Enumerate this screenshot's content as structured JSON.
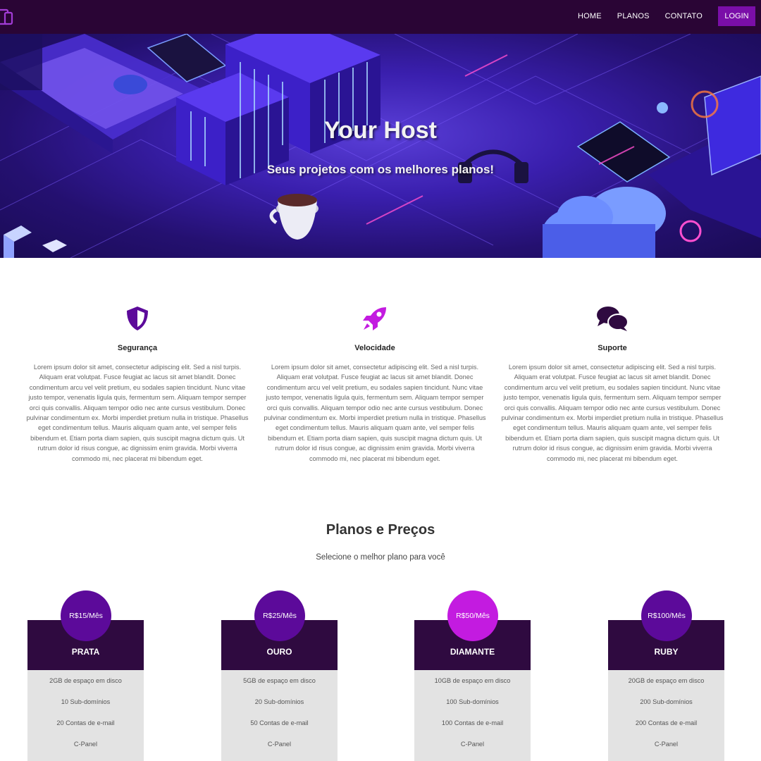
{
  "nav": {
    "logo_icon": "devices-icon",
    "links": [
      {
        "label": "HOME"
      },
      {
        "label": "PLANOS"
      },
      {
        "label": "CONTATO"
      }
    ],
    "login_label": "LOGIN",
    "background": "#2a0535",
    "accent": "#7a0ea8"
  },
  "hero": {
    "title": "Your Host",
    "subtitle": "Seus projetos com os melhores planos!"
  },
  "features": [
    {
      "icon": "shield-icon",
      "title": "Segurança",
      "text": "Lorem ipsum dolor sit amet, consectetur adipiscing elit. Sed a nisl turpis. Aliquam erat volutpat. Fusce feugiat ac lacus sit amet blandit. Donec condimentum arcu vel velit pretium, eu sodales sapien tincidunt. Nunc vitae justo tempor, venenatis ligula quis, fermentum sem. Aliquam tempor semper orci quis convallis. Aliquam tempor odio nec ante cursus vestibulum. Donec pulvinar condimentum ex. Morbi imperdiet pretium nulla in tristique. Phasellus eget condimentum tellus. Mauris aliquam quam ante, vel semper felis bibendum et. Etiam porta diam sapien, quis suscipit magna dictum quis. Ut rutrum dolor id risus congue, ac dignissim enim gravida. Morbi viverra commodo mi, nec placerat mi bibendum eget."
    },
    {
      "icon": "rocket-icon",
      "title": "Velocidade",
      "text": "Lorem ipsum dolor sit amet, consectetur adipiscing elit. Sed a nisl turpis. Aliquam erat volutpat. Fusce feugiat ac lacus sit amet blandit. Donec condimentum arcu vel velit pretium, eu sodales sapien tincidunt. Nunc vitae justo tempor, venenatis ligula quis, fermentum sem. Aliquam tempor semper orci quis convallis. Aliquam tempor odio nec ante cursus vestibulum. Donec pulvinar condimentum ex. Morbi imperdiet pretium nulla in tristique. Phasellus eget condimentum tellus. Mauris aliquam quam ante, vel semper felis bibendum et. Etiam porta diam sapien, quis suscipit magna dictum quis. Ut rutrum dolor id risus congue, ac dignissim enim gravida. Morbi viverra commodo mi, nec placerat mi bibendum eget."
    },
    {
      "icon": "chat-bubbles-icon",
      "title": "Suporte",
      "text": "Lorem ipsum dolor sit amet, consectetur adipiscing elit. Sed a nisl turpis. Aliquam erat volutpat. Fusce feugiat ac lacus sit amet blandit. Donec condimentum arcu vel velit pretium, eu sodales sapien tincidunt. Nunc vitae justo tempor, venenatis ligula quis, fermentum sem. Aliquam tempor semper orci quis convallis. Aliquam tempor odio nec ante cursus vestibulum. Donec pulvinar condimentum ex. Morbi imperdiet pretium nulla in tristique. Phasellus eget condimentum tellus. Mauris aliquam quam ante, vel semper felis bibendum et. Etiam porta diam sapien, quis suscipit magna dictum quis. Ut rutrum dolor id risus congue, ac dignissim enim gravida. Morbi viverra commodo mi, nec placerat mi bibendum eget."
    }
  ],
  "plans_section": {
    "title": "Planos e Preços",
    "subtitle": "Selecione o melhor plano para você"
  },
  "plans": [
    {
      "price": "R$15/Mês",
      "name": "PRATA",
      "price_color": "#5c0a9a",
      "features": [
        "2GB de espaço em disco",
        "10 Sub-domínios",
        "20 Contas de e-mail",
        "C-Panel"
      ]
    },
    {
      "price": "R$25/Mês",
      "name": "OURO",
      "price_color": "#5c0a9a",
      "features": [
        "5GB de espaço em disco",
        "20 Sub-domínios",
        "50 Contas de e-mail",
        "C-Panel"
      ]
    },
    {
      "price": "R$50/Mês",
      "name": "DIAMANTE",
      "price_color": "#c31be0",
      "features": [
        "10GB de espaço em disco",
        "100 Sub-domínios",
        "100 Contas de e-mail",
        "C-Panel"
      ]
    },
    {
      "price": "R$100/Mês",
      "name": "RUBY",
      "price_color": "#5c0a9a",
      "features": [
        "20GB de espaço em disco",
        "200 Sub-domínios",
        "200 Contas de e-mail",
        "C-Panel"
      ]
    }
  ]
}
